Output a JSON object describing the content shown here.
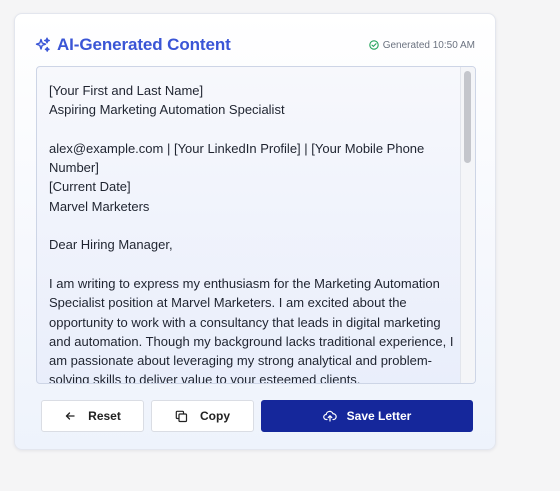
{
  "header": {
    "title": "AI-Generated Content",
    "title_icon": "sparkles-icon",
    "status_icon": "check-circle-icon",
    "status_text": "Generated 10:50 AM"
  },
  "letter": {
    "text": "[Your First and Last Name]\nAspiring Marketing Automation Specialist\n\nalex@example.com | [Your LinkedIn Profile] | [Your Mobile Phone Number]\n[Current Date]\nMarvel Marketers\n\nDear Hiring Manager,\n\nI am writing to express my enthusiasm for the Marketing Automation Specialist position at Marvel Marketers. I am excited about the opportunity to work with a consultancy that leads in digital marketing and automation. Though my background lacks traditional experience, I am passionate about leveraging my strong analytical and problem-solving skills to deliver value to your esteemed clients."
  },
  "actions": {
    "reset_label": "Reset",
    "reset_icon": "arrow-left-icon",
    "copy_label": "Copy",
    "copy_icon": "copy-icon",
    "save_label": "Save Letter",
    "save_icon": "cloud-upload-icon"
  },
  "colors": {
    "accent": "#3a55d6",
    "primary_button": "#15279b",
    "status_check": "#22a35a"
  }
}
